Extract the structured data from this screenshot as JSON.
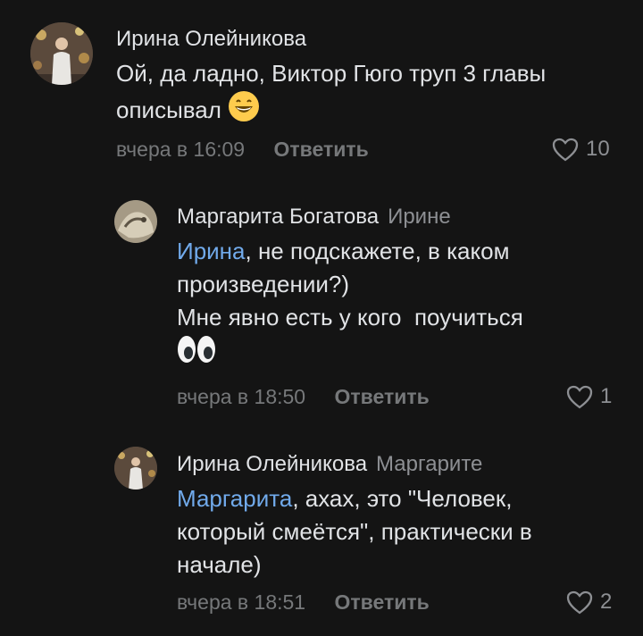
{
  "comments": [
    {
      "author": "Ирина Олейникова",
      "reply_to": "",
      "text": "Ой, да ладно, Виктор Гюго труп 3 главы описывал",
      "emoji": "😄",
      "time": "вчера в 16:09",
      "reply_label": "Ответить",
      "likes": "10"
    },
    {
      "author": "Маргарита Богатова",
      "reply_to": "Ирине",
      "mention": "Ирина",
      "text": ", не подскажете, в каком произведении?)",
      "text2": "Мне явно есть у кого  поучиться",
      "emoji": "👀",
      "time": "вчера в 18:50",
      "reply_label": "Ответить",
      "likes": "1"
    },
    {
      "author": "Ирина Олейникова",
      "reply_to": "Маргарите",
      "mention": "Маргарита",
      "text": ", ахах, это \"Человек, который смеётся\", практически в начале)",
      "time": "вчера в 18:51",
      "reply_label": "Ответить",
      "likes": "2"
    }
  ],
  "colors": {
    "background": "#141414",
    "text": "#e1e3e6",
    "secondary": "#76787a",
    "mention": "#71aaeb"
  }
}
